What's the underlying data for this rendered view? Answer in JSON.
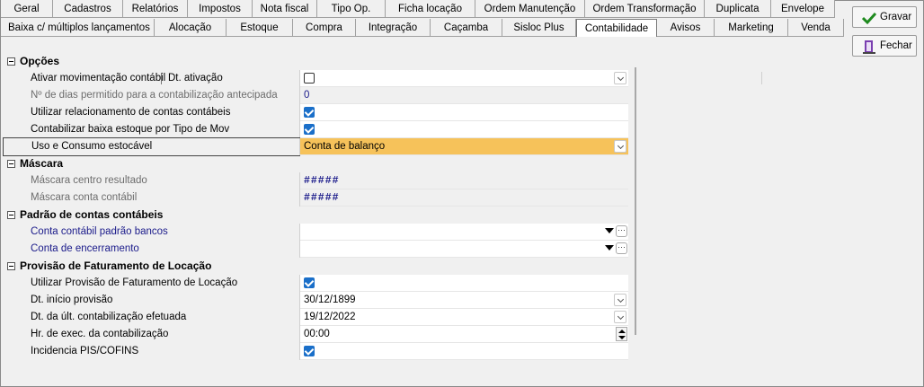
{
  "tabs_row1": [
    "Geral",
    "Cadastros",
    "Relatórios",
    "Impostos",
    "Nota fiscal",
    "Tipo Op.",
    "Ficha locação",
    "Ordem Manutenção",
    "Ordem Transformação",
    "Duplicata",
    "Envelope"
  ],
  "tabs_row2": [
    "Baixa c/ múltiplos lançamentos",
    "Alocação",
    "Estoque",
    "Compra",
    "Integração",
    "Caçamba",
    "Sisloc Plus",
    "Contabilidade",
    "Avisos",
    "Marketing",
    "Venda"
  ],
  "active_tab": "Contabilidade",
  "buttons": {
    "save_label": "Gravar",
    "close_label": "Fechar"
  },
  "sections": {
    "opcoes": {
      "title": "Opções",
      "rows": {
        "ativar_mov": {
          "label": "Ativar movimentação contábil",
          "label2": "Dt. ativação",
          "checked": false
        },
        "dias_permitido": {
          "label": "Nº de dias permitido para a contabilização antecipada",
          "value": "0"
        },
        "relac_contas": {
          "label": "Utilizar relacionamento de contas contábeis",
          "checked": true
        },
        "baixa_estoque": {
          "label": "Contabilizar baixa estoque por Tipo de Mov",
          "checked": true
        },
        "uso_consumo": {
          "label": "Uso e Consumo estocável",
          "value": "Conta de balanço"
        }
      }
    },
    "mascara": {
      "title": "Máscara",
      "rows": {
        "centro_resultado": {
          "label": "Máscara centro resultado",
          "value": "#####"
        },
        "conta_contabil": {
          "label": "Máscara conta contábil",
          "value": "#####"
        }
      }
    },
    "padrao": {
      "title": "Padrão de contas contábeis",
      "rows": {
        "conta_bancos": {
          "label": "Conta contábil padrão bancos",
          "value": ""
        },
        "conta_encerramento": {
          "label": "Conta de encerramento",
          "value": ""
        }
      }
    },
    "provisao": {
      "title": "Provisão de Faturamento de Locação",
      "rows": {
        "utilizar": {
          "label": "Utilizar Provisão de Faturamento de Locação",
          "checked": true
        },
        "dt_inicio": {
          "label": "Dt. início provisão",
          "value": "30/12/1899"
        },
        "dt_ult": {
          "label": "Dt. da últ. contabilização efetuada",
          "value": "19/12/2022"
        },
        "hr_exec": {
          "label": "Hr. de exec. da contabilização",
          "value": "00:00"
        },
        "pis_cofins": {
          "label": "Incidencia PIS/COFINS",
          "checked": true
        }
      }
    }
  },
  "colors": {
    "selection": "#f6c25a",
    "checkbox": "#1a6fc9",
    "category_text": "#000000",
    "link_text": "#1a1a8a"
  }
}
